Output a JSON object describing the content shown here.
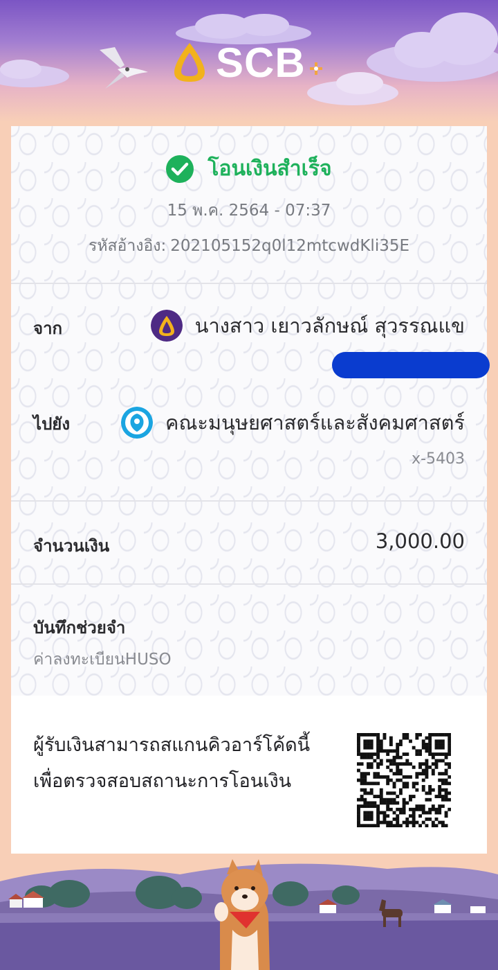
{
  "brand": {
    "name": "SCB",
    "logo_icon": "scb-bai-sema-icon",
    "accent": "#4e2a84",
    "gold": "#f2b21c"
  },
  "receipt": {
    "status": "โอนเงินสำเร็จ",
    "status_color": "#1eb15b",
    "datetime": "15 พ.ค. 2564 - 07:37",
    "reference_label": "รหัสอ้างอิง:",
    "reference_value": "202105152q0l12mtcwdKli35E",
    "from": {
      "label": "จาก",
      "name": "นางสาว เยาวลักษณ์ สุวรรณแข",
      "bank_icon": "scb-bank-icon",
      "account_redacted": true
    },
    "to": {
      "label": "ไปยัง",
      "name": "คณะมนุษยศาสตร์และสังคมศาสตร์",
      "account": "x-5403",
      "bank_icon": "krungthai-bank-icon"
    },
    "amount": {
      "label": "จำนวนเงิน",
      "value": "3,000.00"
    },
    "memo": {
      "label": "บันทึกช่วยจำ",
      "value": "ค่าลงทะเบียนHUSO"
    },
    "qr": {
      "line1": "ผู้รับเงินสามารถสแกนคิวอาร์โค้ดนี้",
      "line2": "เพื่อตรวจสอบสถานะการโอนเงิน"
    }
  }
}
